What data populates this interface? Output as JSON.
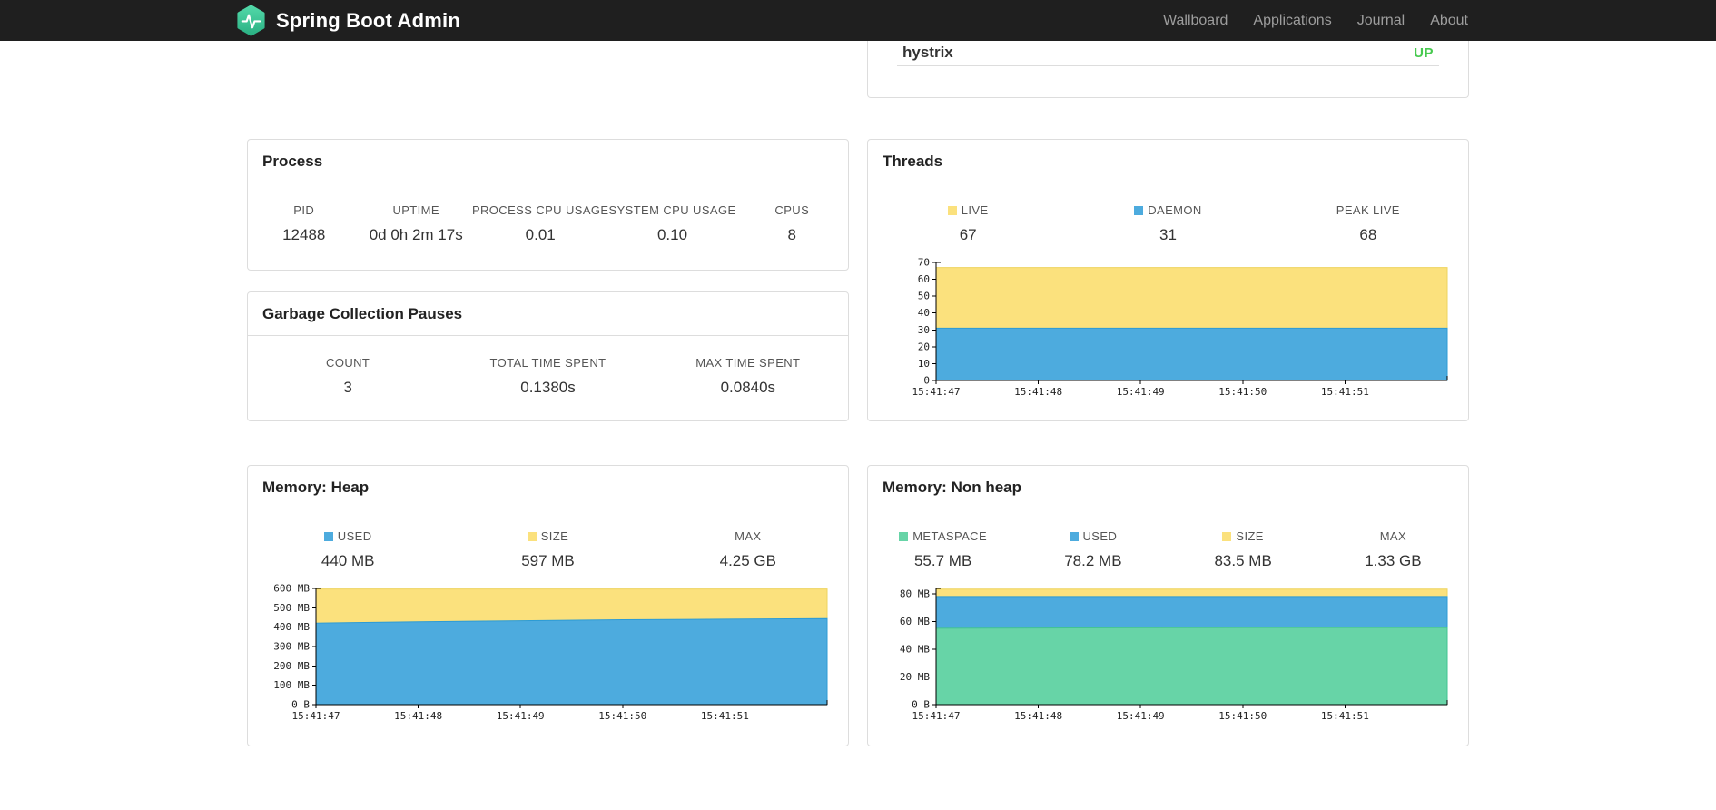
{
  "navbar": {
    "brand": "Spring Boot Admin",
    "items": [
      {
        "label": "Wallboard"
      },
      {
        "label": "Applications"
      },
      {
        "label": "Journal"
      },
      {
        "label": "About"
      }
    ]
  },
  "colors": {
    "status_up": "#47c94f",
    "series_yellow": "#fbe17d",
    "series_blue": "#4dabde",
    "series_green": "#67d4a7",
    "brand_green": "#3ecf8e"
  },
  "status_panel": {
    "rows": [
      {
        "name": "hystrix",
        "status": "UP"
      }
    ]
  },
  "process": {
    "title": "Process",
    "metrics": [
      {
        "label": "PID",
        "value": "12488"
      },
      {
        "label": "UPTIME",
        "value": "0d 0h 2m 17s"
      },
      {
        "label": "PROCESS CPU USAGE",
        "value": "0.01"
      },
      {
        "label": "SYSTEM CPU USAGE",
        "value": "0.10"
      },
      {
        "label": "CPUS",
        "value": "8"
      }
    ]
  },
  "gc": {
    "title": "Garbage Collection Pauses",
    "metrics": [
      {
        "label": "COUNT",
        "value": "3"
      },
      {
        "label": "TOTAL TIME SPENT",
        "value": "0.1380s"
      },
      {
        "label": "MAX TIME SPENT",
        "value": "0.0840s"
      }
    ]
  },
  "threads": {
    "title": "Threads",
    "metrics": [
      {
        "label": "LIVE",
        "value": "67",
        "color": "#fbe17d"
      },
      {
        "label": "DAEMON",
        "value": "31",
        "color": "#4dabde"
      },
      {
        "label": "PEAK LIVE",
        "value": "68"
      }
    ]
  },
  "memory_heap": {
    "title": "Memory: Heap",
    "metrics": [
      {
        "label": "USED",
        "value": "440 MB",
        "color": "#4dabde"
      },
      {
        "label": "SIZE",
        "value": "597 MB",
        "color": "#fbe17d"
      },
      {
        "label": "MAX",
        "value": "4.25 GB"
      }
    ]
  },
  "memory_nonheap": {
    "title": "Memory: Non heap",
    "metrics": [
      {
        "label": "METASPACE",
        "value": "55.7 MB",
        "color": "#67d4a7"
      },
      {
        "label": "USED",
        "value": "78.2 MB",
        "color": "#4dabde"
      },
      {
        "label": "SIZE",
        "value": "83.5 MB",
        "color": "#fbe17d"
      },
      {
        "label": "MAX",
        "value": "1.33 GB"
      }
    ]
  },
  "chart_data": [
    {
      "id": "threads-chart",
      "type": "area",
      "title": "Threads",
      "x": [
        "15:41:47",
        "15:41:48",
        "15:41:49",
        "15:41:50",
        "15:41:51"
      ],
      "ylim": [
        0,
        70
      ],
      "yticks": [
        0,
        10,
        20,
        30,
        40,
        50,
        60,
        70
      ],
      "ytick_labels": [
        "0",
        "10",
        "20",
        "30",
        "40",
        "50",
        "60",
        "70"
      ],
      "grid": false,
      "legend_position": "top",
      "series": [
        {
          "name": "LIVE",
          "color": "#fbe17d",
          "stroke": "#eed45e",
          "values": [
            67,
            67,
            67,
            67,
            67,
            67
          ]
        },
        {
          "name": "DAEMON",
          "color": "#4dabde",
          "stroke": "#2d9bd4",
          "values": [
            31,
            31,
            31,
            31,
            31,
            31
          ]
        }
      ]
    },
    {
      "id": "heap-chart",
      "type": "area",
      "title": "Memory: Heap",
      "x": [
        "15:41:47",
        "15:41:48",
        "15:41:49",
        "15:41:50",
        "15:41:51"
      ],
      "ylim": [
        0,
        600
      ],
      "yticks": [
        0,
        100,
        200,
        300,
        400,
        500,
        600
      ],
      "ytick_labels": [
        "0 B",
        "100 MB",
        "200 MB",
        "300 MB",
        "400 MB",
        "500 MB",
        "600 MB"
      ],
      "grid": false,
      "legend_position": "top",
      "series": [
        {
          "name": "SIZE",
          "color": "#fbe17d",
          "stroke": "#eed45e",
          "values": [
            597,
            597,
            597,
            597,
            597,
            597
          ]
        },
        {
          "name": "USED",
          "color": "#4dabde",
          "stroke": "#2d9bd4",
          "values": [
            421,
            428,
            433,
            438,
            441,
            444
          ]
        }
      ]
    },
    {
      "id": "nonheap-chart",
      "type": "area",
      "title": "Memory: Non heap",
      "x": [
        "15:41:47",
        "15:41:48",
        "15:41:49",
        "15:41:50",
        "15:41:51"
      ],
      "ylim": [
        0,
        84
      ],
      "yticks": [
        0,
        20,
        40,
        60,
        80
      ],
      "ytick_labels": [
        "0 B",
        "20 MB",
        "40 MB",
        "60 MB",
        "80 MB"
      ],
      "grid": false,
      "legend_position": "top",
      "series": [
        {
          "name": "SIZE",
          "color": "#fbe17d",
          "stroke": "#eed45e",
          "values": [
            83.5,
            83.5,
            83.5,
            83.5,
            83.5,
            83.5
          ]
        },
        {
          "name": "USED",
          "color": "#4dabde",
          "stroke": "#2d9bd4",
          "values": [
            78.2,
            78.2,
            78.2,
            78.2,
            78.2,
            78.2
          ]
        },
        {
          "name": "METASPACE",
          "color": "#67d4a7",
          "stroke": "#42c391",
          "values": [
            55.2,
            55.4,
            55.6,
            55.7,
            55.7,
            55.7
          ]
        }
      ]
    }
  ]
}
